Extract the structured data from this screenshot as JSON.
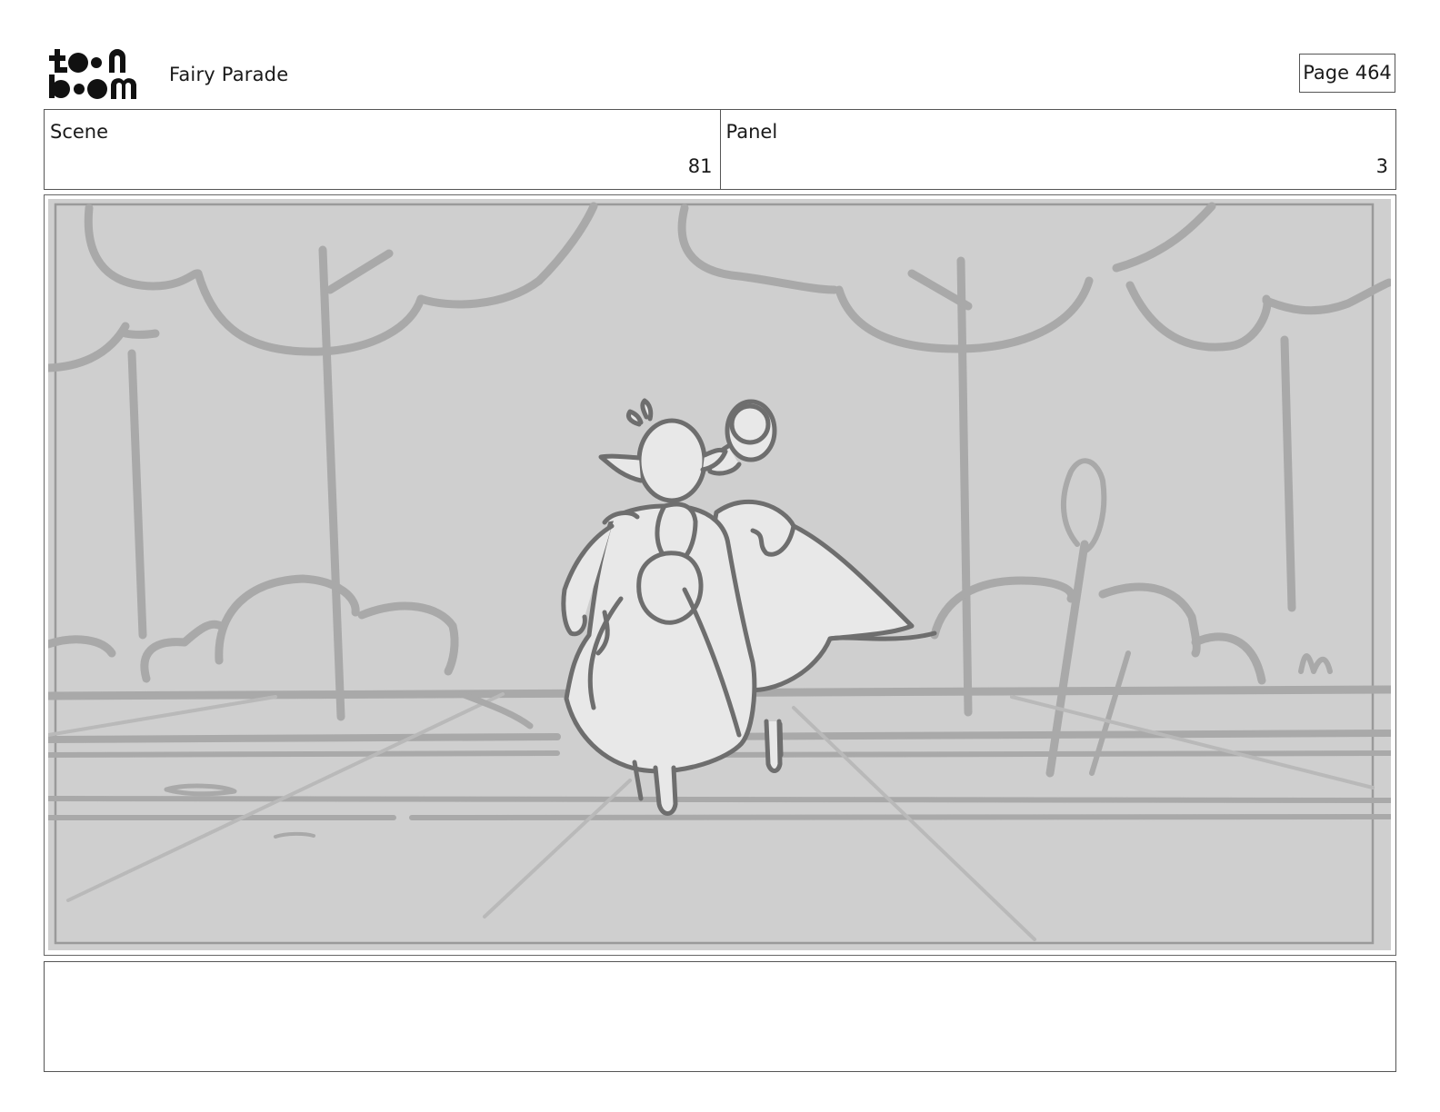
{
  "header": {
    "logo_text": "toonboom",
    "project_title": "Fairy Parade",
    "page_label": "Page 464"
  },
  "info": {
    "scene_label": "Scene",
    "scene_value": "81",
    "panel_label": "Panel",
    "panel_value": "3"
  },
  "notes": {
    "text": ""
  },
  "colors": {
    "panel_background": "#cfcfcf",
    "background_strokes": "#a9a9a9",
    "character_fill": "#e8e8e8",
    "character_stroke": "#6e6e6e"
  }
}
